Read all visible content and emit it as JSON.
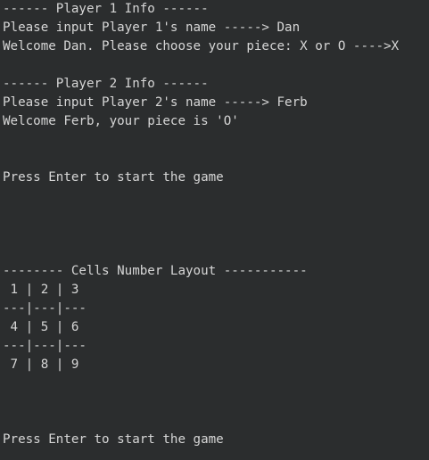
{
  "terminal": {
    "lines": [
      "------ Player 1 Info ------",
      "Please input Player 1's name -----> Dan",
      "Welcome Dan. Please choose your piece: X or O ---->X",
      "",
      "------ Player 2 Info ------",
      "Please input Player 2's name -----> Ferb",
      "Welcome Ferb, your piece is 'O'",
      "",
      "",
      "Press Enter to start the game",
      "",
      "",
      "",
      "",
      "-------- Cells Number Layout -----------",
      " 1 | 2 | 3",
      "---|---|---",
      " 4 | 5 | 6",
      "---|---|---",
      " 7 | 8 | 9",
      "",
      "",
      "",
      "Press Enter to start the game"
    ]
  }
}
